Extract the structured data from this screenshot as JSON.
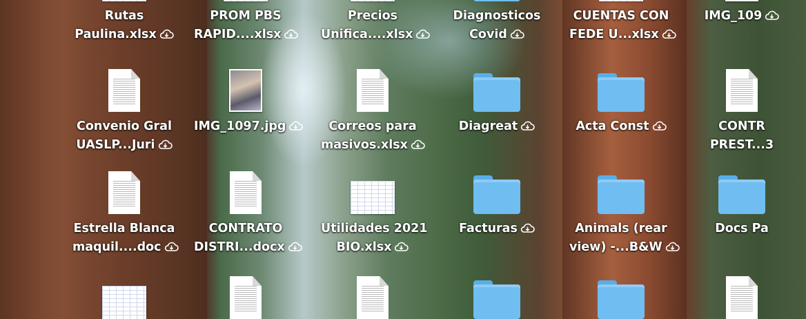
{
  "desktop": {
    "icons": [
      {
        "kind": "spreadsheet",
        "line1": "Rutas",
        "line2": "Paulina.xlsx",
        "cloud": true
      },
      {
        "kind": "spreadsheet",
        "line1": "PROM PBS",
        "line2": "RAPID....xlsx",
        "cloud": true
      },
      {
        "kind": "spreadsheet",
        "line1": "Precios",
        "line2": "Unifica....xlsx",
        "cloud": true
      },
      {
        "kind": "folder",
        "line1": "Diagnosticos",
        "line2": "Covid",
        "cloud": true
      },
      {
        "kind": "spreadsheet",
        "line1": "CUENTAS CON",
        "line2": "FEDE U...xlsx",
        "cloud": true
      },
      {
        "kind": "image",
        "line1": "IMG_109",
        "line2": "",
        "cloud": true
      },
      {
        "kind": "document",
        "line1": "Convenio Gral",
        "line2": "UASLP...Juri",
        "cloud": true
      },
      {
        "kind": "image",
        "line1": "IMG_1097.jpg",
        "line2": "",
        "cloud": true
      },
      {
        "kind": "document",
        "line1": "Correos para",
        "line2": "masivos.xlsx",
        "cloud": true
      },
      {
        "kind": "folder",
        "line1": "Diagreat",
        "line2": "",
        "cloud": true
      },
      {
        "kind": "folder",
        "line1": "Acta Const",
        "line2": "",
        "cloud": true
      },
      {
        "kind": "document",
        "line1": "CONTR",
        "line2": "PREST...3",
        "cloud": false
      },
      {
        "kind": "document",
        "line1": "Estrella Blanca",
        "line2": "maquil....doc",
        "cloud": true
      },
      {
        "kind": "document",
        "line1": "CONTRATO",
        "line2": "DISTRI...docx",
        "cloud": true
      },
      {
        "kind": "spreadsheet",
        "line1": "Utilidades 2021",
        "line2": "BIO.xlsx",
        "cloud": true
      },
      {
        "kind": "folder",
        "line1": "Facturas",
        "line2": "",
        "cloud": true
      },
      {
        "kind": "folder",
        "line1": "Animals (rear",
        "line2": "view) -...B&W",
        "cloud": true
      },
      {
        "kind": "folder",
        "line1": "Docs Pa",
        "line2": "",
        "cloud": false
      },
      {
        "kind": "spreadsheet",
        "line1": "",
        "line2": "",
        "cloud": false
      },
      {
        "kind": "document",
        "line1": "",
        "line2": "",
        "cloud": false
      },
      {
        "kind": "document",
        "line1": "",
        "line2": "",
        "cloud": false
      },
      {
        "kind": "folder",
        "line1": "",
        "line2": "",
        "cloud": false
      },
      {
        "kind": "folder",
        "line1": "",
        "line2": "",
        "cloud": false
      },
      {
        "kind": "document",
        "line1": "",
        "line2": "",
        "cloud": false
      }
    ]
  },
  "colors": {
    "folder": "#70bdf2",
    "label": "#ffffff"
  }
}
